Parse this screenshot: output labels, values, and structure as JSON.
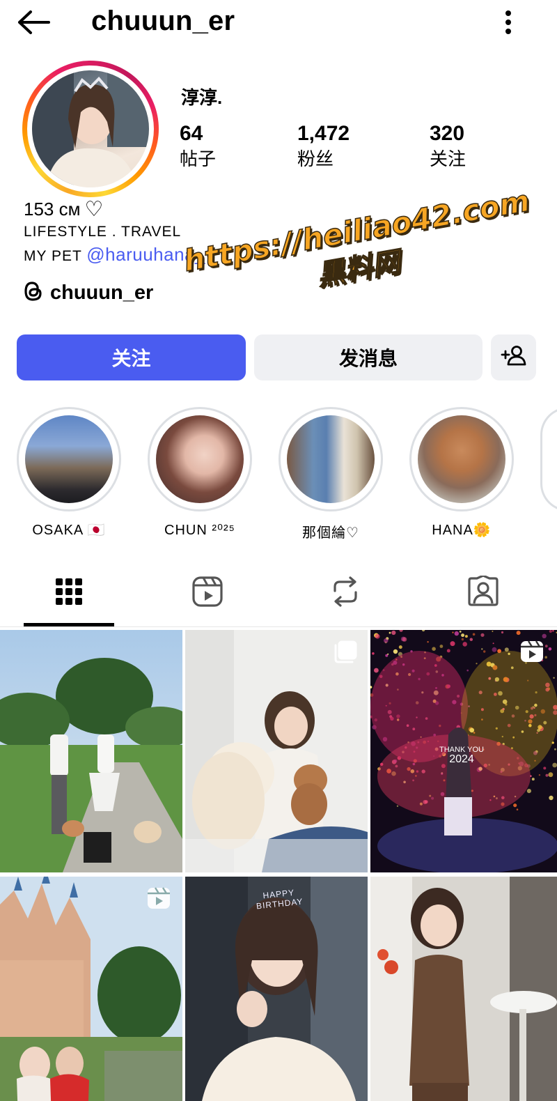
{
  "header": {
    "username": "chuuun_er"
  },
  "profile": {
    "display_name": "淳淳.",
    "stats": [
      {
        "value": "64",
        "label": "帖子"
      },
      {
        "value": "1,472",
        "label": "粉丝"
      },
      {
        "value": "320",
        "label": "关注"
      }
    ],
    "bio": {
      "line1": "153 cм",
      "line1_symbol": "♡",
      "line2": "LIFESTYLE . TRAVEL",
      "line3_prefix": "MY PET",
      "line3_mention": "@haruuhana_"
    },
    "threads_handle": "chuuun_er"
  },
  "watermark": {
    "url": "https://heiliao42.com",
    "label": "黑料网"
  },
  "actions": {
    "follow_label": "关注",
    "message_label": "发消息"
  },
  "highlights": [
    {
      "label": "OSAKA 🇯🇵"
    },
    {
      "label": "CHUN ²⁰²⁵"
    },
    {
      "label": "那個綸♡"
    },
    {
      "label": "HANA🌼"
    }
  ],
  "tabs": [
    {
      "icon": "grid-icon",
      "active": true
    },
    {
      "icon": "reels-icon",
      "active": false
    },
    {
      "icon": "reposts-icon",
      "active": false
    },
    {
      "icon": "tagged-icon",
      "active": false
    }
  ],
  "posts": [
    {
      "badge": "none"
    },
    {
      "badge": "carousel-icon"
    },
    {
      "badge": "reel-icon",
      "overlay_text_1": "THANK YOU",
      "overlay_text_2": "2024"
    },
    {
      "badge": "reel-icon"
    },
    {
      "badge": "none",
      "overlay_text_1": "HAPPY BIRTHDAY"
    },
    {
      "badge": "none"
    }
  ],
  "colors": {
    "accent": "#4a5cf0",
    "button_gray": "#eff0f3",
    "watermark": "#f7a623"
  }
}
